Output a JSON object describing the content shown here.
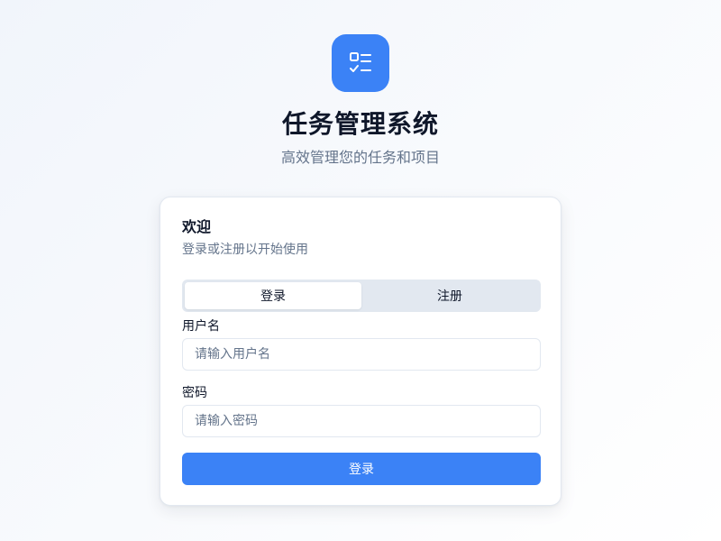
{
  "app": {
    "title": "任务管理系统",
    "subtitle": "高效管理您的任务和项目",
    "logo_icon": "checklist-icon",
    "accent_color": "#3b82f6"
  },
  "card": {
    "title": "欢迎",
    "description": "登录或注册以开始使用"
  },
  "tabs": [
    {
      "label": "登录",
      "active": true
    },
    {
      "label": "注册",
      "active": false
    }
  ],
  "form": {
    "username": {
      "label": "用户名",
      "placeholder": "请输入用户名",
      "value": ""
    },
    "password": {
      "label": "密码",
      "placeholder": "请输入密码",
      "value": ""
    },
    "submit_label": "登录"
  }
}
